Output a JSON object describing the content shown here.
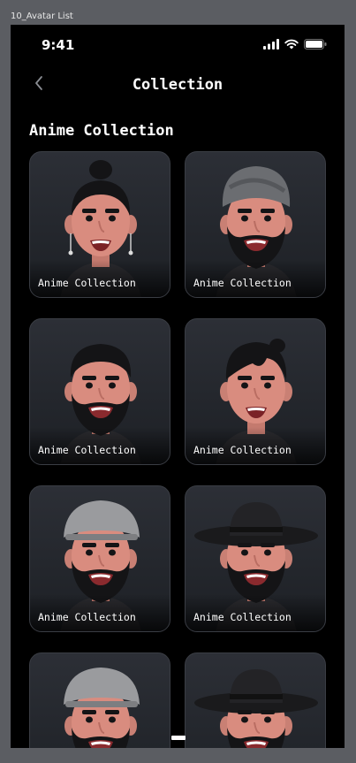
{
  "frame": {
    "label": "10_Avatar List"
  },
  "status_bar": {
    "time": "9:41",
    "icons": [
      "cellular-signal-icon",
      "wifi-icon",
      "battery-icon"
    ]
  },
  "nav": {
    "title": "Collection",
    "back_icon": "chevron-left-icon"
  },
  "section": {
    "title": "Anime Collection"
  },
  "cards": [
    {
      "label": "Anime Collection",
      "avatar": "topknot-earrings"
    },
    {
      "label": "Anime Collection",
      "avatar": "turban-beard"
    },
    {
      "label": "Anime Collection",
      "avatar": "short-hair-beard"
    },
    {
      "label": "Anime Collection",
      "avatar": "bun-stubble"
    },
    {
      "label": "Anime Collection",
      "avatar": "gray-cap-beard"
    },
    {
      "label": "Anime Collection",
      "avatar": "black-hat-beard"
    },
    {
      "label": "",
      "avatar": "gray-cap-beard"
    },
    {
      "label": "",
      "avatar": "black-hat-beard"
    }
  ],
  "colors": {
    "background": "#000000",
    "card": "#25282e",
    "skin": "#d98c7f",
    "text": "#ffffff"
  }
}
